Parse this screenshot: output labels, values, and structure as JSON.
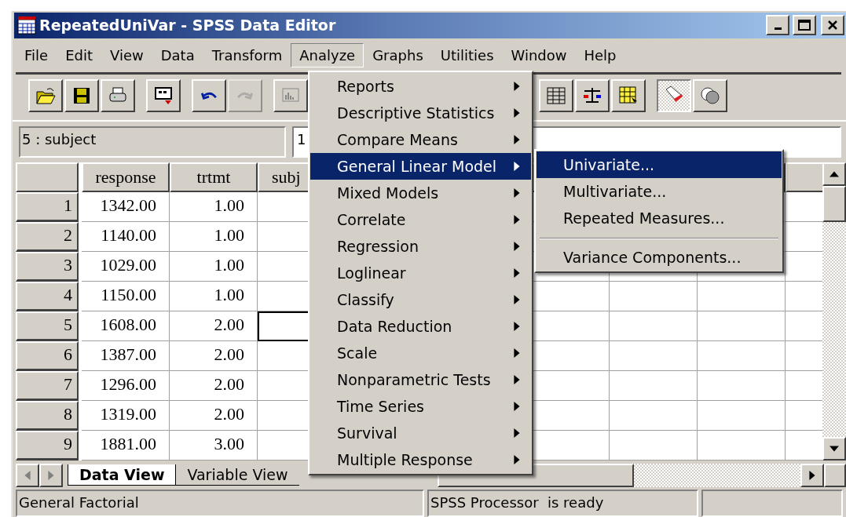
{
  "window": {
    "title": "RepeatedUniVar - SPSS Data Editor"
  },
  "menu_bar": [
    {
      "label": "File",
      "selected": false
    },
    {
      "label": "Edit",
      "selected": false
    },
    {
      "label": "View",
      "selected": false
    },
    {
      "label": "Data",
      "selected": false
    },
    {
      "label": "Transform",
      "selected": false
    },
    {
      "label": "Analyze",
      "selected": true
    },
    {
      "label": "Graphs",
      "selected": false
    },
    {
      "label": "Utilities",
      "selected": false
    },
    {
      "label": "Window",
      "selected": false
    },
    {
      "label": "Help",
      "selected": false
    }
  ],
  "toolbar": [
    {
      "kind": "open",
      "pressed": false,
      "disabled": false
    },
    {
      "kind": "save",
      "pressed": false,
      "disabled": false
    },
    {
      "kind": "print",
      "pressed": false,
      "disabled": false
    },
    {
      "kind": "dialog",
      "pressed": false,
      "disabled": false
    },
    {
      "kind": "undo",
      "pressed": false,
      "disabled": false
    },
    {
      "kind": "redo",
      "pressed": false,
      "disabled": true
    },
    {
      "kind": "chart",
      "pressed": false,
      "disabled": false
    },
    {
      "kind": "grid",
      "pressed": false,
      "disabled": false
    },
    {
      "kind": "scale",
      "pressed": false,
      "disabled": false
    },
    {
      "kind": "table",
      "pressed": false,
      "disabled": false
    },
    {
      "kind": "tag",
      "pressed": true,
      "disabled": false
    },
    {
      "kind": "sets",
      "pressed": false,
      "disabled": false
    }
  ],
  "cell_editor": {
    "cell": "5 : subject",
    "value": "1"
  },
  "table": {
    "columns": [
      "response",
      "trtmt",
      "subj"
    ],
    "rows": [
      {
        "number": "1",
        "cells": [
          "1342.00",
          "1.00"
        ],
        "selected": false
      },
      {
        "number": "2",
        "cells": [
          "1140.00",
          "1.00"
        ],
        "selected": false
      },
      {
        "number": "3",
        "cells": [
          "1029.00",
          "1.00"
        ],
        "selected": false
      },
      {
        "number": "4",
        "cells": [
          "1150.00",
          "1.00"
        ],
        "selected": false
      },
      {
        "number": "5",
        "cells": [
          "1608.00",
          "2.00"
        ],
        "selected": true
      },
      {
        "number": "6",
        "cells": [
          "1387.00",
          "2.00"
        ],
        "selected": false
      },
      {
        "number": "7",
        "cells": [
          "1296.00",
          "2.00"
        ],
        "selected": false
      },
      {
        "number": "8",
        "cells": [
          "1319.00",
          "2.00"
        ],
        "selected": false
      },
      {
        "number": "9",
        "cells": [
          "1881.00",
          "3.00"
        ],
        "selected": false
      }
    ]
  },
  "view_tabs": [
    {
      "label": "Data View",
      "selected": true
    },
    {
      "label": "Variable View",
      "selected": false
    }
  ],
  "analyze_menu": [
    {
      "label": "Reports",
      "selected": false
    },
    {
      "label": "Descriptive Statistics",
      "selected": false
    },
    {
      "label": "Compare Means",
      "selected": false
    },
    {
      "label": "General Linear Model",
      "selected": true
    },
    {
      "label": "Mixed Models",
      "selected": false
    },
    {
      "label": "Correlate",
      "selected": false
    },
    {
      "label": "Regression",
      "selected": false
    },
    {
      "label": "Loglinear",
      "selected": false
    },
    {
      "label": "Classify",
      "selected": false
    },
    {
      "label": "Data Reduction",
      "selected": false
    },
    {
      "label": "Scale",
      "selected": false
    },
    {
      "label": "Nonparametric Tests",
      "selected": false
    },
    {
      "label": "Time Series",
      "selected": false
    },
    {
      "label": "Survival",
      "selected": false
    },
    {
      "label": "Multiple Response",
      "selected": false
    }
  ],
  "submenu": [
    {
      "kind": "item",
      "label": "Univariate...",
      "selected": true
    },
    {
      "kind": "item",
      "label": "Multivariate...",
      "selected": false
    },
    {
      "kind": "item",
      "label": "Repeated Measures...",
      "selected": false
    },
    {
      "kind": "separator"
    },
    {
      "kind": "item",
      "label": "Variance Components...",
      "selected": false
    }
  ],
  "status_bar": {
    "left": "General Factorial",
    "processor": "SPSS Processor  is ready"
  }
}
